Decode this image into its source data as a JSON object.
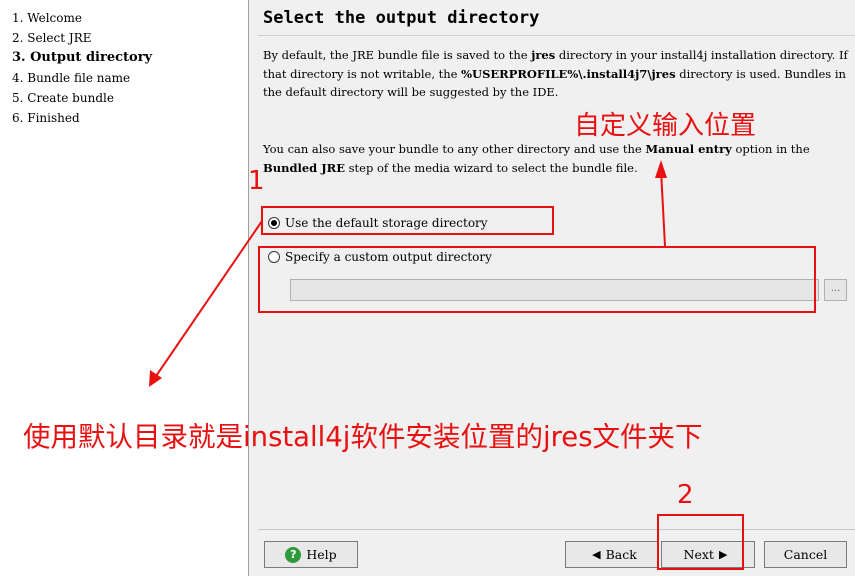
{
  "steps": [
    {
      "label": "1. Welcome",
      "active": false
    },
    {
      "label": "2. Select JRE",
      "active": false
    },
    {
      "label": "3. Output directory",
      "active": true
    },
    {
      "label": "4. Bundle file name",
      "active": false
    },
    {
      "label": "5. Create bundle",
      "active": false
    },
    {
      "label": "6. Finished",
      "active": false
    }
  ],
  "main": {
    "heading": "Select the output directory",
    "para1": {
      "t1": "By default, the JRE bundle file is saved to the ",
      "b1": "jres",
      "t2": " directory in your install4j installation directory. If that directory is not writable, the ",
      "b2": "%USERPROFILE%\\.install4j7\\jres",
      "t3": " directory is used. Bundles in the default directory will be suggested by the IDE."
    },
    "para2": {
      "t1": "You can also save your bundle to any other directory and use the ",
      "b1": "Manual entry",
      "t2": " option in the ",
      "b2": "Bundled JRE",
      "t3": " step of the media wizard to select the bundle file."
    },
    "option_default": {
      "label": "Use the default storage directory",
      "checked": true
    },
    "option_custom": {
      "label": "Specify a custom output directory",
      "checked": false
    },
    "custom_dir_value": "",
    "browse_label": "..."
  },
  "buttons": {
    "help": "Help",
    "back": "Back",
    "next": "Next",
    "cancel": "Cancel"
  },
  "annotations": {
    "custom_label": "自定义输入位置",
    "default_label": "使用默认目录就是install4j软件安装位置的jres文件夹下",
    "num1": "1",
    "num2": "2",
    "color": "#e81010"
  }
}
